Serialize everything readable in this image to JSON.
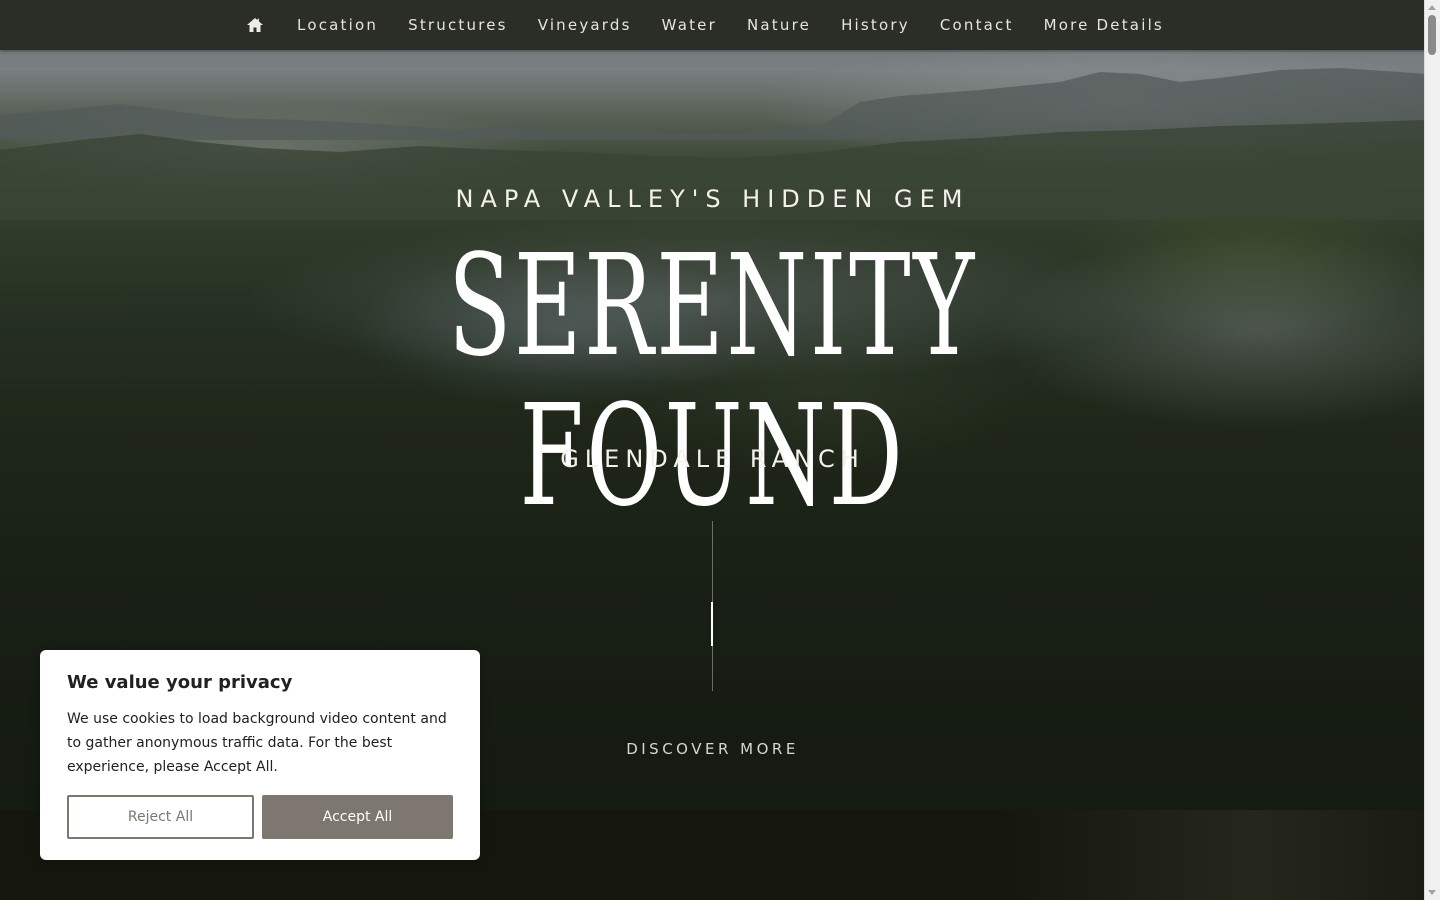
{
  "nav": {
    "home_icon": "home-icon",
    "items": [
      "Location",
      "Structures",
      "Vineyards",
      "Water",
      "Nature",
      "History",
      "Contact",
      "More Details"
    ]
  },
  "hero": {
    "eyebrow": "NAPA VALLEY'S HIDDEN GEM",
    "headline": "SERENITY FOUND",
    "subtitle": "GLENDALE RANCH",
    "cta": "DISCOVER MORE"
  },
  "cookie_banner": {
    "title": "We value your privacy",
    "body": "We use cookies to load background video content and to gather anonymous traffic data. For the best experience, please Accept All.",
    "reject_label": "Reject All",
    "accept_label": "Accept All"
  },
  "colors": {
    "nav_bg": "#2b2e27",
    "button_accent": "#7d776f",
    "footer_band": "#15170f"
  }
}
